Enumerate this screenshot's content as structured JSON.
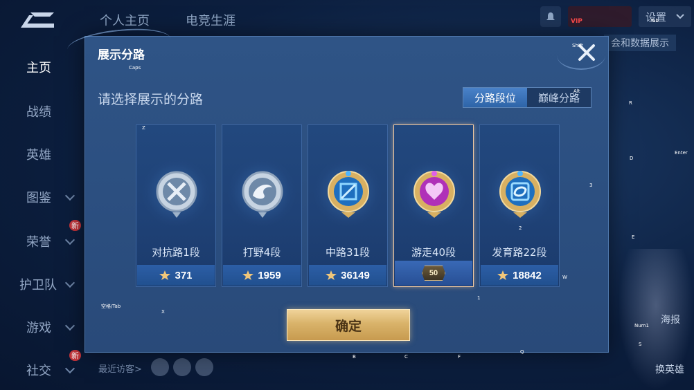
{
  "app": {
    "top_tabs": [
      "个人主页",
      "电竞生涯"
    ],
    "settings_label": "设置",
    "data_show_label": "会和数据展示",
    "sidebar": [
      {
        "label": "主页",
        "active": true
      },
      {
        "label": "战绩"
      },
      {
        "label": "英雄"
      },
      {
        "label": "图鉴",
        "caret": true
      },
      {
        "label": "荣誉",
        "caret": true,
        "new": true
      },
      {
        "label": "护卫队",
        "caret": true
      },
      {
        "label": "游戏",
        "caret": true
      },
      {
        "label": "社交",
        "caret": true,
        "new": true
      }
    ],
    "new_tag": "新",
    "recent_visitors": "最近访客>",
    "right_labels": [
      "海报",
      "换英雄"
    ]
  },
  "modal": {
    "title": "展示分路",
    "subtitle": "请选择展示的分路",
    "toggle": [
      {
        "label": "分路段位",
        "active": true
      },
      {
        "label": "巅峰分路",
        "active": false
      }
    ],
    "cards": [
      {
        "label": "对抗路1段",
        "score": "371",
        "icon": "silver-sword-badge-icon",
        "selected": false
      },
      {
        "label": "打野4段",
        "score": "1959",
        "icon": "silver-dragon-badge-icon",
        "selected": false
      },
      {
        "label": "中路31段",
        "score": "36149",
        "icon": "gold-mage-badge-icon",
        "selected": false
      },
      {
        "label": "游走40段",
        "score": "",
        "icon": "purple-support-badge-icon",
        "selected": true,
        "star": "50"
      },
      {
        "label": "发育路22段",
        "score": "18842",
        "icon": "gold-marksman-badge-icon",
        "selected": false
      }
    ],
    "confirm_label": "确定",
    "colors": {
      "accent_gold": "#d9b36a",
      "selected_border": "#f0c9a2",
      "panel": "#2f5486"
    }
  },
  "key_hints": [
    "Caps",
    "Shift",
    "Alt",
    "Z",
    "X",
    "B",
    "C",
    "F",
    "Q",
    "R",
    "D",
    "E",
    "W",
    "S",
    "1",
    "2",
    "3",
    "Enter",
    "Num1",
    "Tab",
    "空格/Tab"
  ]
}
